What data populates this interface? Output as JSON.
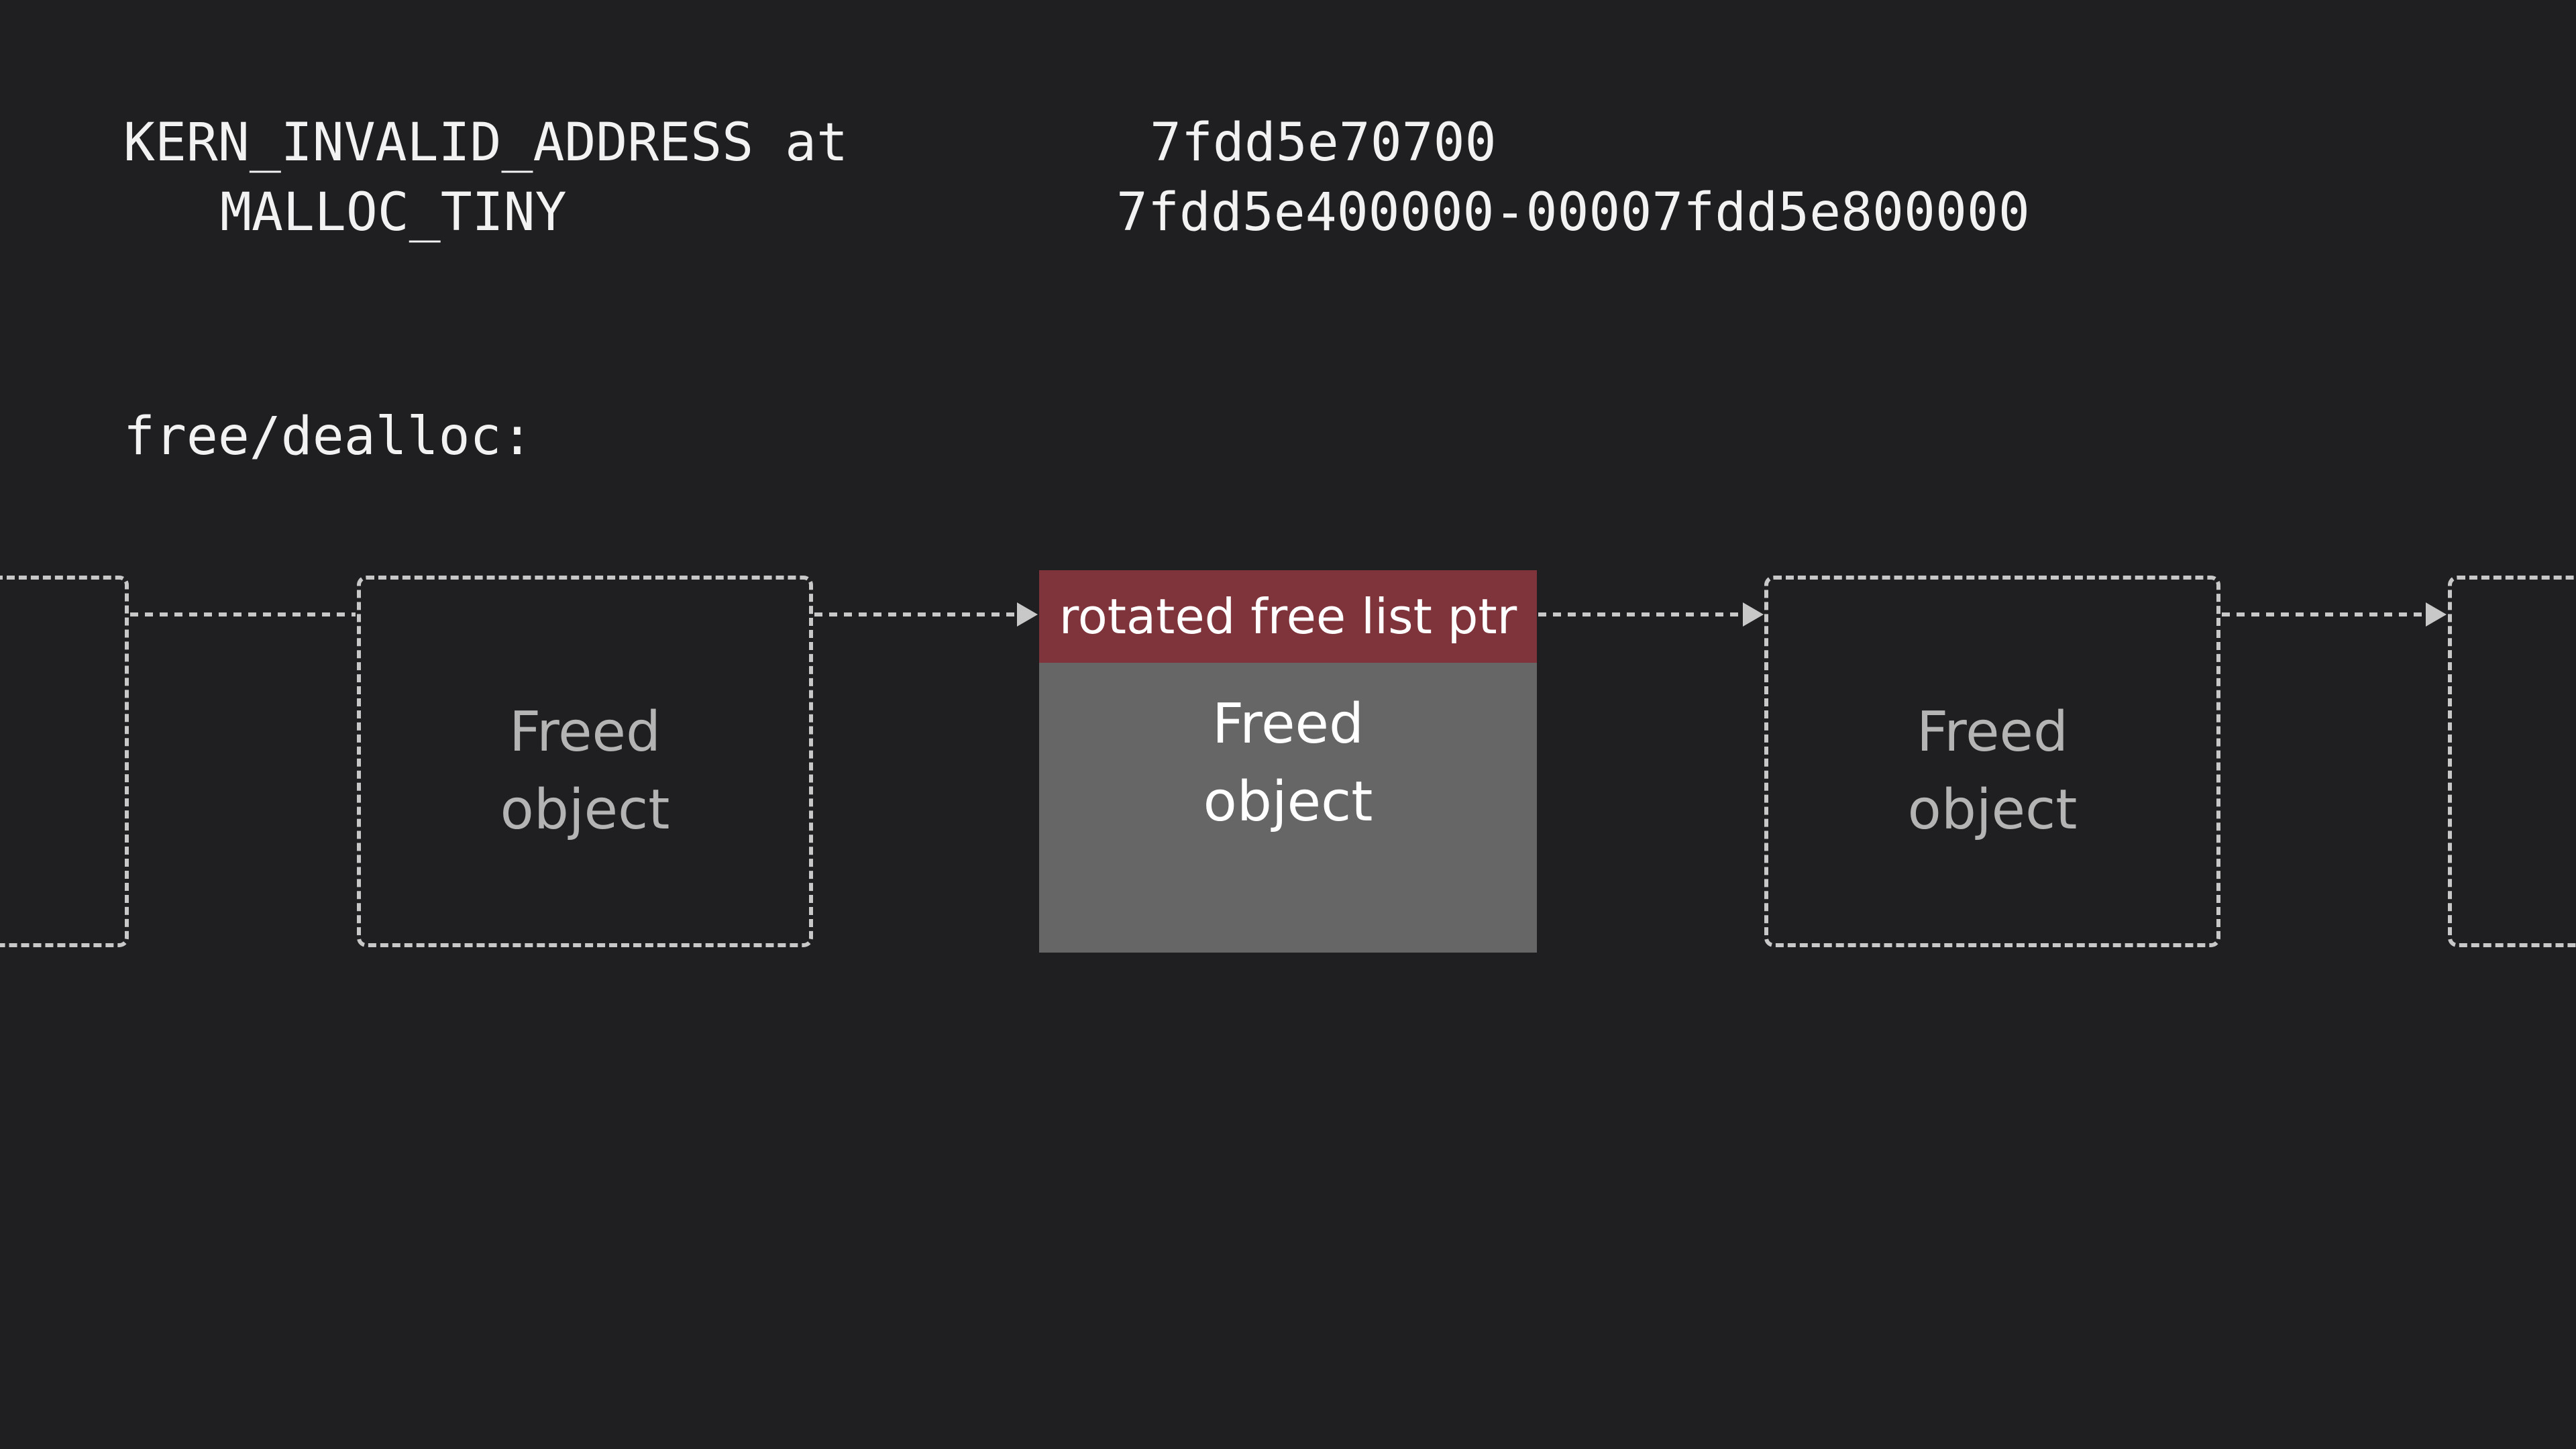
{
  "crash": {
    "exception_label": "KERN_INVALID_ADDRESS at",
    "exception_address": "7fdd5e70700",
    "region_label": "MALLOC_TINY",
    "region_range": "7fdd5e400000-00007fdd5e800000"
  },
  "operation_label": "free/dealloc:",
  "free_list": {
    "objects": [
      {
        "line1": "Freed",
        "line2": "object"
      },
      {
        "header": "rotated free list ptr",
        "line1": "Freed",
        "line2": "object"
      },
      {
        "line1": "Freed",
        "line2": "object"
      }
    ]
  },
  "colors": {
    "background": "#1f1f21",
    "highlight_header": "#7f343c",
    "highlight_body": "#666666",
    "dashed_outline": "#c8c8c8"
  }
}
